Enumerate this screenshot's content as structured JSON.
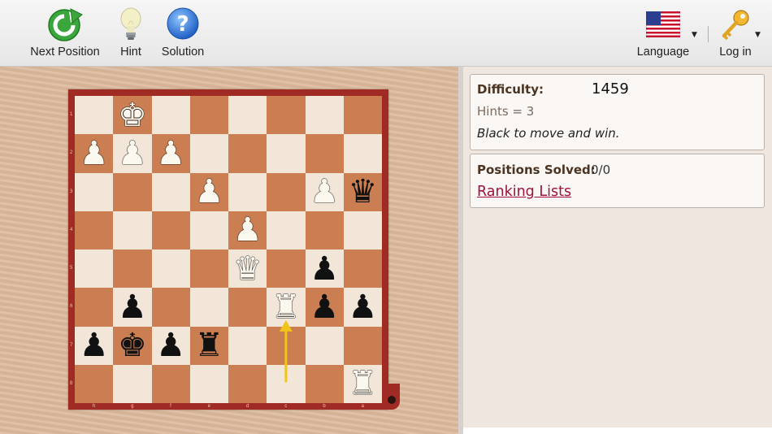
{
  "toolbar": {
    "next_position": "Next Position",
    "hint": "Hint",
    "solution": "Solution",
    "language": "Language",
    "login": "Log in"
  },
  "icons": {
    "next_position": "green-refresh-icon",
    "hint": "lightbulb-icon",
    "solution": "question-mark-icon",
    "language": "us-flag-icon",
    "login": "key-icon"
  },
  "colors": {
    "light_square": "#f2e6d8",
    "dark_square": "#cb7e52",
    "frame": "#a02a24",
    "link": "#a0103a",
    "arrow": "#f0c419"
  },
  "board": {
    "orientation": "black-bottom",
    "rank_labels": [
      "1",
      "2",
      "3",
      "4",
      "5",
      "6",
      "7",
      "8"
    ],
    "file_labels": [
      "h",
      "g",
      "f",
      "e",
      "d",
      "c",
      "b",
      "a"
    ],
    "rows": [
      [
        "",
        "wK",
        "",
        "",
        "",
        "",
        "",
        ""
      ],
      [
        "wP",
        "wP",
        "wP",
        "",
        "",
        "",
        "",
        ""
      ],
      [
        "",
        "",
        "",
        "wP",
        "",
        "",
        "wP",
        "bQ"
      ],
      [
        "",
        "",
        "",
        "",
        "wP",
        "",
        "",
        ""
      ],
      [
        "",
        "",
        "",
        "",
        "wQ",
        "",
        "bP",
        ""
      ],
      [
        "",
        "bP",
        "",
        "",
        "",
        "wR",
        "bP",
        "bP"
      ],
      [
        "bP",
        "bK",
        "bP",
        "bR",
        "",
        "",
        "",
        ""
      ],
      [
        "",
        "",
        "",
        "",
        "",
        "",
        "",
        "wR"
      ]
    ],
    "arrow": {
      "from": "c8",
      "to": "c6"
    }
  },
  "info": {
    "difficulty_label": "Difficulty:",
    "difficulty_value": "1459",
    "hints_text": "Hints = 3",
    "task_text": "Black to move and win.",
    "solved_label": "Positions Solved:",
    "solved_value": "0/0",
    "ranking_link": "Ranking Lists"
  }
}
